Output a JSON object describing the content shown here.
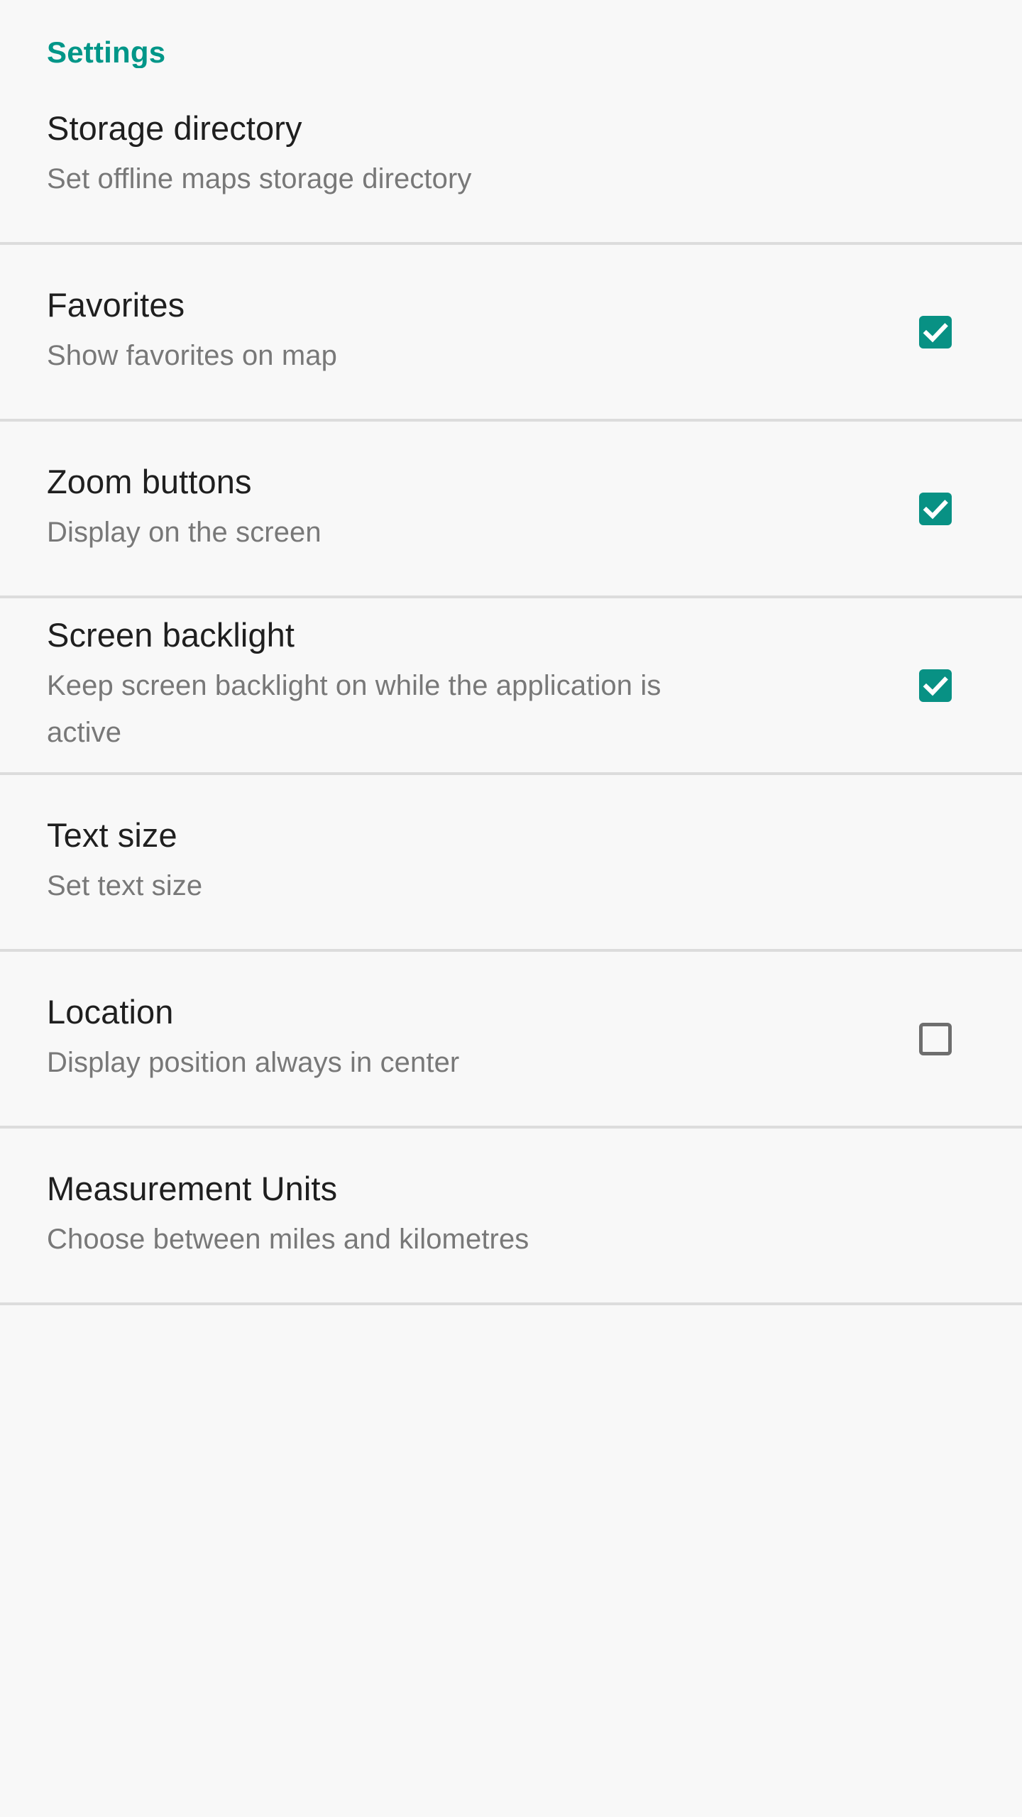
{
  "theme": {
    "background": "#f8f8f8",
    "accent": "#009688",
    "checkbox_fill": "#089184",
    "checkbox_outline": "#6e6e6e",
    "title_color": "#1f1f1f",
    "summary_color": "#787878",
    "divider_color": "#dcdcdc"
  },
  "category": {
    "title": "Settings"
  },
  "preferences": [
    {
      "key": "storage-directory",
      "title": "Storage directory",
      "summary": "Set offline maps storage directory",
      "widget": "none",
      "checked": false
    },
    {
      "key": "favorites",
      "title": "Favorites",
      "summary": "Show favorites on map",
      "widget": "checkbox",
      "checked": true
    },
    {
      "key": "zoom-buttons",
      "title": "Zoom buttons",
      "summary": "Display on the screen",
      "widget": "checkbox",
      "checked": true
    },
    {
      "key": "screen-backlight",
      "title": "Screen backlight",
      "summary": "Keep screen backlight on while the application is active",
      "widget": "checkbox",
      "checked": true
    },
    {
      "key": "text-size",
      "title": "Text size",
      "summary": "Set text size",
      "widget": "none",
      "checked": false
    },
    {
      "key": "location",
      "title": "Location",
      "summary": "Display position always in center",
      "widget": "checkbox",
      "checked": false
    },
    {
      "key": "measurement-units",
      "title": "Measurement Units",
      "summary": "Choose between miles and kilometres",
      "widget": "none",
      "checked": false
    }
  ]
}
